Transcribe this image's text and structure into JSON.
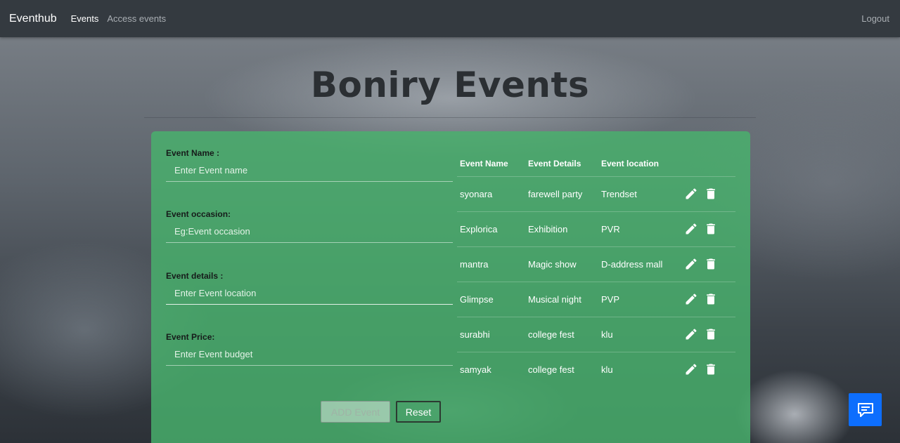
{
  "navbar": {
    "brand": "Eventhub",
    "links": [
      {
        "label": "Events",
        "active": true
      },
      {
        "label": "Access events",
        "active": false
      }
    ],
    "logout_label": "Logout"
  },
  "page": {
    "title": "Boniry Events"
  },
  "form": {
    "fields": [
      {
        "label": "Event Name :",
        "placeholder": "Enter Event name"
      },
      {
        "label": "Event occasion:",
        "placeholder": "Eg:Event occasion"
      },
      {
        "label": "Event details :",
        "placeholder": "Enter Event location"
      },
      {
        "label": "Event Price:",
        "placeholder": "Enter Event budget"
      }
    ],
    "add_button_label": "ADD Event",
    "reset_button_label": "Reset"
  },
  "table": {
    "headers": [
      "Event Name",
      "Event Details",
      "Event location"
    ],
    "rows": [
      [
        "syonara",
        "farewell party",
        "Trendset"
      ],
      [
        "Explorica",
        "Exhibition",
        "PVR"
      ],
      [
        "mantra",
        "Magic show",
        "D-address mall"
      ],
      [
        "Glimpse",
        "Musical night",
        "PVP"
      ],
      [
        "surabhi",
        "college fest",
        "klu"
      ],
      [
        "samyak",
        "college fest",
        "klu"
      ]
    ],
    "row_actions": [
      "edit-icon",
      "delete-icon"
    ]
  },
  "chat_widget": {
    "icon": "chat-icon"
  },
  "colors": {
    "navbar": "#343a40",
    "panel": "#48b26c",
    "chat_button": "#0d6efd"
  }
}
